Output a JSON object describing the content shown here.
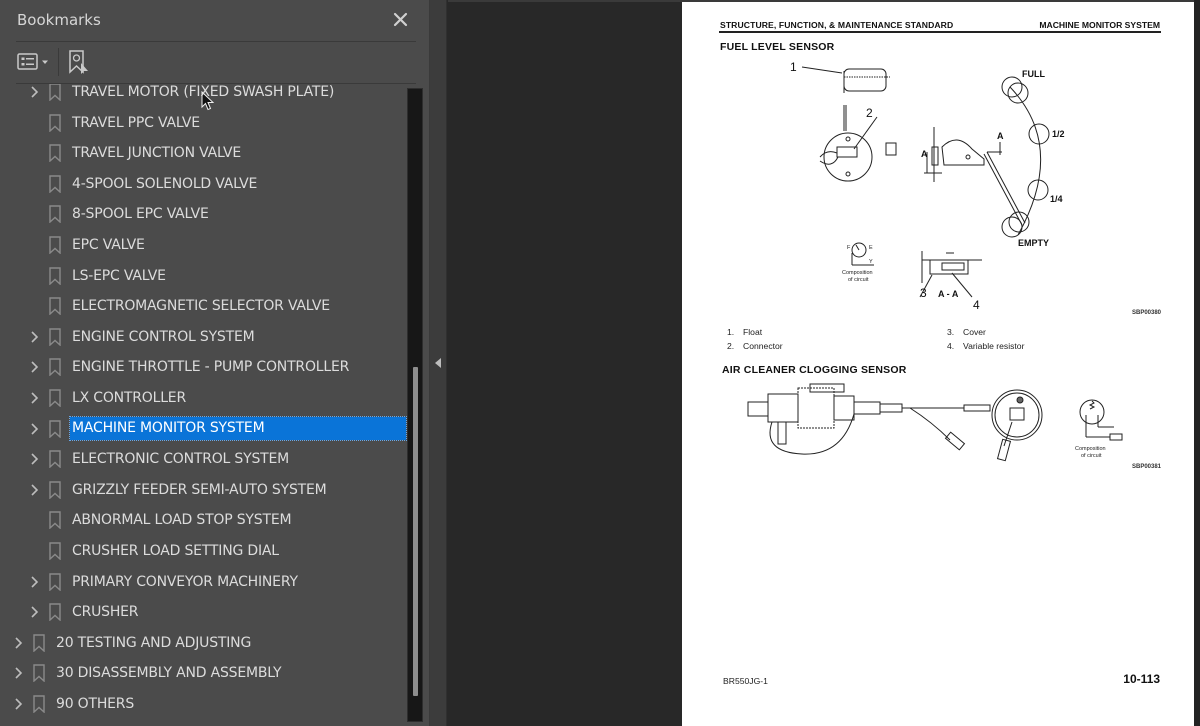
{
  "bookmarks_panel": {
    "title": "Bookmarks",
    "close_icon": "close-icon",
    "toolbar": {
      "options_icon": "list-options-icon",
      "find_current_icon": "find-current-bookmark-icon"
    },
    "items": [
      {
        "label": "TRAVEL MOTOR (FIXED SWASH PLATE)",
        "level": 2,
        "expandable": true,
        "selected": false
      },
      {
        "label": "TRAVEL PPC VALVE",
        "level": 2,
        "expandable": false,
        "selected": false
      },
      {
        "label": "TRAVEL JUNCTION VALVE",
        "level": 2,
        "expandable": false,
        "selected": false
      },
      {
        "label": "4-SPOOL SOLENOLD VALVE",
        "level": 2,
        "expandable": false,
        "selected": false
      },
      {
        "label": "8-SPOOL EPC VALVE",
        "level": 2,
        "expandable": false,
        "selected": false
      },
      {
        "label": "EPC VALVE",
        "level": 2,
        "expandable": false,
        "selected": false
      },
      {
        "label": "LS-EPC VALVE",
        "level": 2,
        "expandable": false,
        "selected": false
      },
      {
        "label": "ELECTROMAGNETIC SELECTOR VALVE",
        "level": 2,
        "expandable": false,
        "selected": false
      },
      {
        "label": "ENGINE CONTROL SYSTEM",
        "level": 2,
        "expandable": true,
        "selected": false
      },
      {
        "label": "ENGINE THROTTLE - PUMP CONTROLLER",
        "level": 2,
        "expandable": true,
        "selected": false
      },
      {
        "label": "LX CONTROLLER",
        "level": 2,
        "expandable": true,
        "selected": false
      },
      {
        "label": "MACHINE MONITOR SYSTEM",
        "level": 2,
        "expandable": true,
        "selected": true
      },
      {
        "label": "ELECTRONIC CONTROL SYSTEM",
        "level": 2,
        "expandable": true,
        "selected": false
      },
      {
        "label": "GRIZZLY FEEDER SEMI-AUTO SYSTEM",
        "level": 2,
        "expandable": true,
        "selected": false
      },
      {
        "label": "ABNORMAL LOAD STOP SYSTEM",
        "level": 2,
        "expandable": false,
        "selected": false
      },
      {
        "label": "CRUSHER LOAD SETTING DIAL",
        "level": 2,
        "expandable": false,
        "selected": false
      },
      {
        "label": "PRIMARY CONVEYOR MACHINERY",
        "level": 2,
        "expandable": true,
        "selected": false
      },
      {
        "label": "CRUSHER",
        "level": 2,
        "expandable": true,
        "selected": false
      },
      {
        "label": "20 TESTING AND ADJUSTING",
        "level": 1,
        "expandable": true,
        "selected": false
      },
      {
        "label": "30 DISASSEMBLY AND ASSEMBLY",
        "level": 1,
        "expandable": true,
        "selected": false
      },
      {
        "label": "90 OTHERS",
        "level": 1,
        "expandable": true,
        "selected": false
      }
    ],
    "scroll": {
      "thumb_start_fraction": 0.44,
      "thumb_end_fraction": 0.96
    }
  },
  "splitter": {
    "collapse_icon": "collapse-left-arrow-icon"
  },
  "colors": {
    "selection": "#0a74d8",
    "panel_bg": "#4b4b4b",
    "doc_bg": "#282828"
  },
  "document_page": {
    "header_left": "STRUCTURE, FUNCTION, & MAINTENANCE STANDARD",
    "header_right": "MACHINE MONITOR SYSTEM",
    "section1": {
      "title": "FUEL LEVEL SENSOR",
      "gauge_labels": [
        "FULL",
        "1/2",
        "1/4",
        "EMPTY"
      ],
      "callouts": [
        "1",
        "2",
        "3",
        "4"
      ],
      "section_mark": "A",
      "section_view": "A - A",
      "circuit_labels": [
        "F",
        "E",
        "Y"
      ],
      "circuit_caption_1": "Composition",
      "circuit_caption_2": "of circuit",
      "figure_code": "SBP00380",
      "legend": [
        {
          "num": "1.",
          "text": "Float"
        },
        {
          "num": "2.",
          "text": "Connector"
        },
        {
          "num": "3.",
          "text": "Cover"
        },
        {
          "num": "4.",
          "text": "Variable resistor"
        }
      ]
    },
    "section2": {
      "title": "AIR CLEANER CLOGGING SENSOR",
      "circuit_caption_1": "Composition",
      "circuit_caption_2": "of circuit",
      "figure_code": "SBP00381"
    },
    "footer_left": "BR550JG-1",
    "footer_right": "10-113"
  }
}
